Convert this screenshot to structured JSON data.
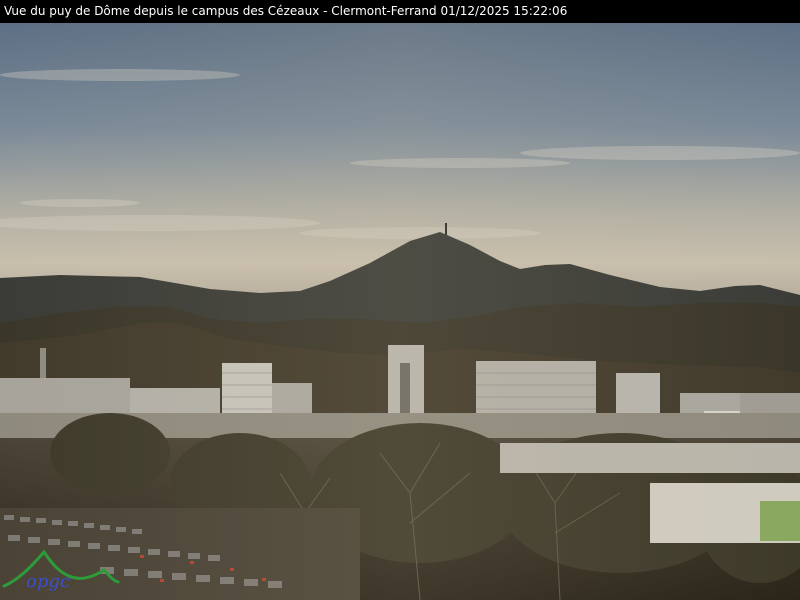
{
  "caption": {
    "title": "Vue du puy de Dôme depuis le campus des Cézeaux - Clermont-Ferrand",
    "timestamp": "01/12/2025 15:22:06"
  },
  "logo": {
    "text": "opgc",
    "colors": {
      "swoosh": "#2e9a3a",
      "letters": "#3a4fd0"
    }
  },
  "colors": {
    "sky_top": "#5f7186",
    "sky_horizon": "#c9bfae",
    "mountain": "#3a3b35",
    "foreground": "#3a3326"
  }
}
